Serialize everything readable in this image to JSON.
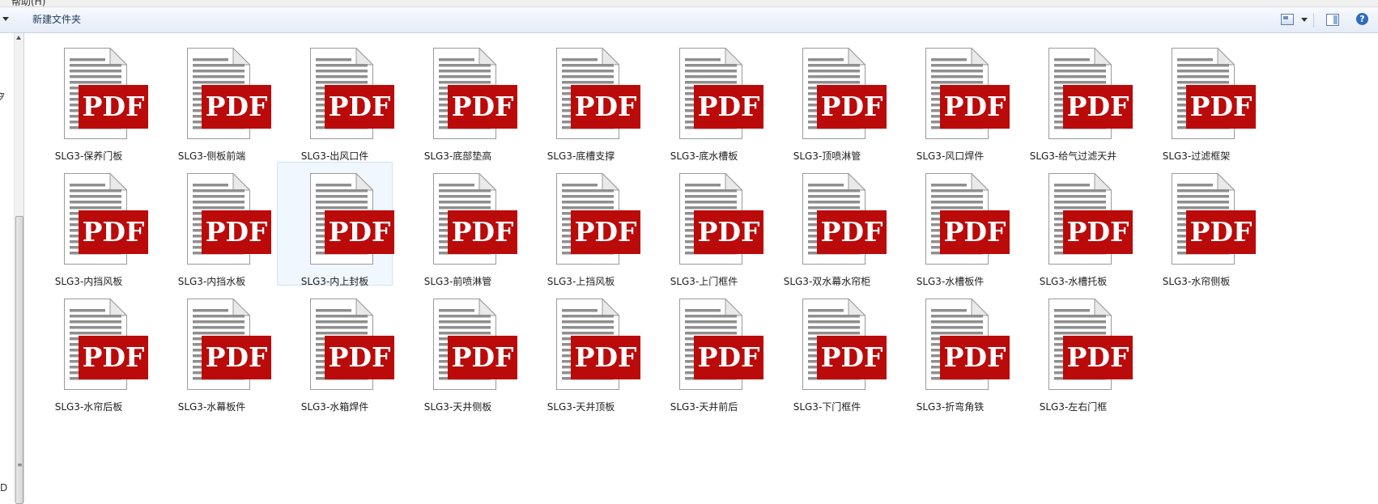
{
  "menu": {
    "partial_label": "帮助(H)"
  },
  "toolbar": {
    "new_folder_label": "新建文件夹",
    "view_icon": "view-icon",
    "preview_icon": "preview-pane-icon",
    "help_icon": "help-icon",
    "help_glyph": "?"
  },
  "nav": {
    "cut_text_1": "穸",
    "cut_text_2": "D"
  },
  "file_icon": {
    "badge_text": "PDF",
    "badge_color": "#bb0a0a",
    "selected_bg": "#f1f7fe"
  },
  "files": [
    {
      "name": "SLG3-保养门板"
    },
    {
      "name": "SLG3-侧板前端"
    },
    {
      "name": "SLG3-出风口件"
    },
    {
      "name": "SLG3-底部垫高"
    },
    {
      "name": "SLG3-底槽支撑"
    },
    {
      "name": "SLG3-底水槽板"
    },
    {
      "name": "SLG3-顶喷淋管"
    },
    {
      "name": "SLG3-风口焊件"
    },
    {
      "name": "SLG3-给气过滤天井"
    },
    {
      "name": "SLG3-过滤框架"
    },
    {
      "name": "SLG3-内挡风板"
    },
    {
      "name": "SLG3-内挡水板"
    },
    {
      "name": "SLG3-内上封板",
      "selected": true
    },
    {
      "name": "SLG3-前喷淋管"
    },
    {
      "name": "SLG3-上挡风板"
    },
    {
      "name": "SLG3-上门框件"
    },
    {
      "name": "SLG3-双水幕水帘柜"
    },
    {
      "name": "SLG3-水槽板件"
    },
    {
      "name": "SLG3-水槽托板"
    },
    {
      "name": "SLG3-水帘侧板"
    },
    {
      "name": "SLG3-水帘后板"
    },
    {
      "name": "SLG3-水幕板件"
    },
    {
      "name": "SLG3-水箱焊件"
    },
    {
      "name": "SLG3-天井侧板"
    },
    {
      "name": "SLG3-天井顶板"
    },
    {
      "name": "SLG3-天井前后"
    },
    {
      "name": "SLG3-下门框件"
    },
    {
      "name": "SLG3-折弯角铁"
    },
    {
      "name": "SLG3-左右门框"
    }
  ]
}
